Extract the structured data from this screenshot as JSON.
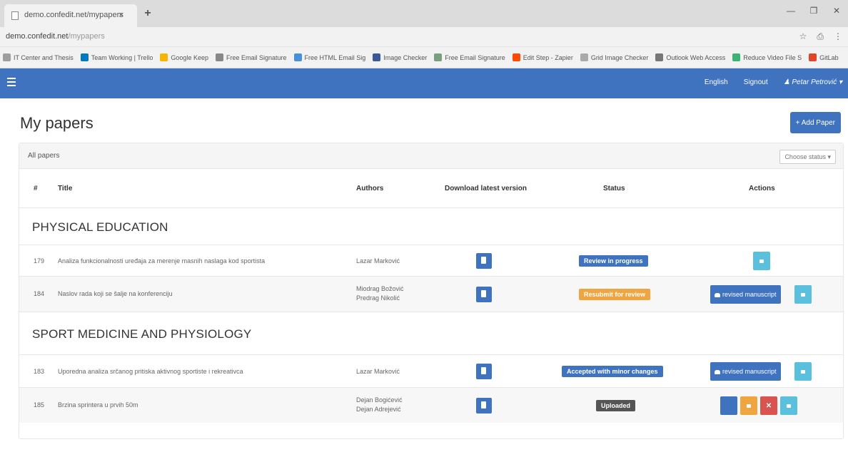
{
  "browser": {
    "tab_title": "demo.confedit.net/mypapers",
    "tab_close": "×",
    "new_tab": "+",
    "url_host": "demo.confedit.net",
    "url_path": "/mypapers",
    "bookmarks": [
      {
        "label": "IT Center and Thesis",
        "color": "#9e9e9e"
      },
      {
        "label": "Team Working | Trello",
        "color": "#0079bf"
      },
      {
        "label": "Google Keep",
        "color": "#f7b500"
      },
      {
        "label": "Free Email Signature",
        "color": "#888888"
      },
      {
        "label": "Free HTML Email Sig",
        "color": "#4a90d9"
      },
      {
        "label": "Image Checker",
        "color": "#3b5998"
      },
      {
        "label": "Free Email Signature",
        "color": "#7a9e7e"
      },
      {
        "label": "Edit Step - Zapier",
        "color": "#ff4a00"
      },
      {
        "label": "Grid Image Checker",
        "color": "#aaaaaa"
      },
      {
        "label": "Outlook Web Access",
        "color": "#777777"
      },
      {
        "label": "Reduce Video File S",
        "color": "#3cb371"
      },
      {
        "label": "GitLab",
        "color": "#e24329"
      }
    ]
  },
  "navbar": {
    "lang": "English",
    "signout": "Signout",
    "user": "Petar Petrović ▾"
  },
  "page": {
    "title": "My papers",
    "add_paper": "+ Add Paper"
  },
  "panel": {
    "title": "All papers",
    "status_select": "Choose status ▾"
  },
  "table": {
    "headers": [
      "#",
      "Title",
      "Authors",
      "Download latest version",
      "Status",
      "Actions"
    ]
  },
  "groups": [
    {
      "title": "PHYSICAL EDUCATION"
    },
    {
      "title": "SPORT MEDICINE AND PHYSIOLOGY"
    }
  ],
  "rows": [
    {
      "id": "179",
      "title": "Analiza funkcionalnosti uređaja za merenje masnih naslaga kod sportista",
      "authors": [
        "Lazar Marković"
      ],
      "status": "Review in progress",
      "status_color": "#3f73bf"
    },
    {
      "id": "184",
      "title": "Naslov rada koji se šalje na konferenciju",
      "authors": [
        "Miodrag Božović",
        "Predrag Nikolić"
      ],
      "status": "Resubmit for review",
      "status_color": "#f0a640",
      "revised_label": "revised manuscript"
    },
    {
      "id": "183",
      "title": "Uporedna analiza srčanog pritiska aktivnog sportiste i rekreativca",
      "authors": [
        "Lazar Marković"
      ],
      "status": "Accepted with minor changes",
      "status_color": "#3f73bf",
      "revised_label": "revised manuscript"
    },
    {
      "id": "185",
      "title": "Brzina sprintera u prvih 50m",
      "authors": [
        "Dejan Bogićević",
        "Dejan Adrejević"
      ],
      "status": "Uploaded",
      "status_color": "#555555"
    }
  ],
  "colors": {
    "primary": "#3f73bf",
    "info": "#5bc0de",
    "warning": "#f0a640",
    "danger": "#d9534f"
  }
}
